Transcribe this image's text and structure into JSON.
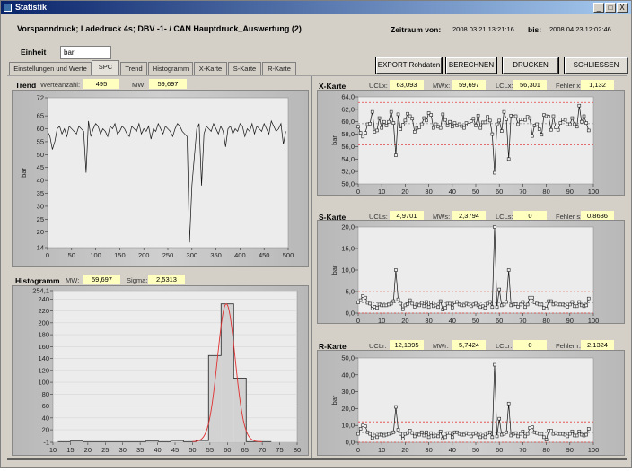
{
  "window": {
    "title": "Statistik",
    "minimize": "_",
    "maximize": "□",
    "close": "X"
  },
  "header": {
    "title": "Vorspanndruck; Ladedruck 4s; DBV -1- / CAN Hauptdruck_Auswertung (2)",
    "zeitraum_label": "Zeitraum von:",
    "from": "2008.03.21 13:21:16",
    "bis_label": "bis:",
    "to": "2008.04.23 12:02:46"
  },
  "einheit": {
    "label": "Einheit",
    "value": "bar"
  },
  "tabs": [
    {
      "label": "Einstellungen und Werte"
    },
    {
      "label": "SPC",
      "active": true
    },
    {
      "label": "Trend"
    },
    {
      "label": "Histogramm"
    },
    {
      "label": "X-Karte"
    },
    {
      "label": "S-Karte"
    },
    {
      "label": "R-Karte"
    }
  ],
  "buttons": {
    "export": "EXPORT Rohdaten",
    "berechnen": "BERECHNEN",
    "drucken": "DRUCKEN",
    "schliessen": "SCHLIESSEN"
  },
  "trend": {
    "title": "Trend",
    "count_label": "Werteanzahl:",
    "count": "495",
    "mw_label": "MW:",
    "mw": "59,697"
  },
  "histogram": {
    "title": "Histogramm",
    "mw_label": "MW:",
    "mw": "59,697",
    "sigma_label": "Sigma:",
    "sigma": "2,5313"
  },
  "xkarte": {
    "title": "X-Karte",
    "ucl_label": "UCLx:",
    "ucl": "63,093",
    "mw_label": "MWx:",
    "mw": "59,697",
    "lcl_label": "LCLx:",
    "lcl": "56,301",
    "err_label": "Fehler x:",
    "err": "1,132"
  },
  "skarte": {
    "title": "S-Karte",
    "ucl_label": "UCLs:",
    "ucl": "4,9701",
    "mw_label": "MWs:",
    "mw": "2,3794",
    "lcl_label": "LCLs:",
    "lcl": "0",
    "err_label": "Fehler s:",
    "err": "0,8636"
  },
  "rkarte": {
    "title": "R-Karte",
    "ucl_label": "UCLr:",
    "ucl": "12,1395",
    "mw_label": "MWr:",
    "mw": "5,7424",
    "lcl_label": "LCLr:",
    "lcl": "0",
    "err_label": "Fehler r:",
    "err": "2,1324"
  },
  "chart_data": [
    {
      "id": "trend",
      "type": "line",
      "ylabel": "bar",
      "xlim": [
        0,
        500
      ],
      "ylim": [
        14,
        72
      ],
      "xticks": [
        0,
        50,
        100,
        150,
        200,
        250,
        300,
        350,
        400,
        450,
        500
      ],
      "yticks": [
        14,
        20,
        25,
        30,
        35,
        40,
        45,
        50,
        55,
        60,
        65,
        72
      ],
      "x_start": 0,
      "x_step": 5,
      "values": [
        59,
        57,
        52,
        55,
        60,
        61,
        58,
        60,
        57,
        61,
        60,
        59,
        58,
        61,
        60,
        59,
        43,
        63,
        57,
        60,
        62,
        61,
        58,
        60,
        59,
        57,
        61,
        60,
        62,
        58,
        59,
        61,
        60,
        58,
        57,
        61,
        60,
        59,
        62,
        58,
        60,
        59,
        61,
        56,
        60,
        59,
        62,
        60,
        58,
        61,
        60,
        59,
        57,
        60,
        62,
        61,
        59,
        58,
        57,
        16,
        38,
        49,
        60,
        62,
        38,
        58,
        61,
        60,
        59,
        62,
        60,
        58,
        61,
        59,
        53,
        60,
        61,
        58,
        60,
        59,
        62,
        61,
        57,
        60,
        59,
        62,
        58,
        61,
        60,
        59,
        62,
        60,
        58,
        63,
        61,
        59,
        60,
        62,
        54,
        59
      ],
      "color": "#000000"
    },
    {
      "id": "histogram",
      "type": "bar",
      "xlim": [
        10,
        80
      ],
      "ylim": [
        -1,
        254.1
      ],
      "xticks": [
        10,
        15,
        20,
        25,
        30,
        35,
        40,
        45,
        50,
        55,
        60,
        65,
        70,
        75,
        80
      ],
      "yticks": [
        -1,
        20,
        40,
        60,
        80,
        100,
        120,
        140,
        160,
        180,
        200,
        220,
        240,
        254.1
      ],
      "bin_edges": [
        11.4,
        15,
        18.6,
        22.2,
        25.8,
        29.4,
        33,
        36.6,
        40.2,
        43.8,
        47.4,
        51,
        54.6,
        58.2,
        61.8,
        65.4,
        69,
        72.6
      ],
      "values": [
        0,
        1,
        0,
        0,
        0,
        0,
        0,
        1,
        0,
        2,
        0,
        2,
        145,
        232,
        107,
        0,
        0
      ],
      "fit": {
        "type": "normal",
        "mean": 59.697,
        "sigma": 2.5313,
        "color": "#e03030"
      }
    },
    {
      "id": "xkarte",
      "type": "line",
      "ylabel": "bar",
      "xlim": [
        0,
        100
      ],
      "ylim": [
        50,
        64
      ],
      "xticks": [
        0,
        10,
        20,
        30,
        40,
        50,
        60,
        70,
        80,
        90,
        100
      ],
      "yticks": [
        50,
        52,
        54,
        56,
        58,
        60,
        62,
        64
      ],
      "ucl": 63.093,
      "center": 59.697,
      "lcl": 56.301,
      "values": [
        59.2,
        58.2,
        57.6,
        58.2,
        59.6,
        59.7,
        61.6,
        58.4,
        58.6,
        60.6,
        59,
        60,
        59.4,
        60,
        61.6,
        59.8,
        54.6,
        61.2,
        58.8,
        59.5,
        60.2,
        61.3,
        60.9,
        60.5,
        58.4,
        59,
        59.1,
        59.6,
        60.6,
        60.2,
        61.4,
        61.1,
        59,
        59.6,
        59.2,
        59,
        61.2,
        60.3,
        59.4,
        60,
        59.2,
        59.8,
        59.4,
        59.6,
        59.3,
        59,
        59.8,
        59.5,
        60.1,
        60.5,
        59.4,
        61,
        59,
        59.9,
        59.9,
        60.8,
        60.2,
        58,
        51.8,
        59.6,
        60.2,
        58.5,
        61.6,
        60.4,
        54,
        61,
        60.8,
        60.9,
        59.6,
        60.4,
        60.4,
        60.3,
        60.8,
        60.6,
        57.7,
        59.4,
        59.6,
        58.8,
        57.9,
        61.1,
        60.9,
        60.8,
        58.7,
        60.9,
        59.1,
        58.7,
        59.8,
        60.4,
        60.3,
        59.6,
        59.6,
        60.6,
        59.6,
        59.2,
        62.6,
        60,
        60.9,
        59.8,
        58.6
      ]
    },
    {
      "id": "skarte",
      "type": "line",
      "ylabel": "bar",
      "xlim": [
        0,
        100
      ],
      "ylim": [
        0,
        20
      ],
      "xticks": [
        0,
        10,
        20,
        30,
        40,
        50,
        60,
        70,
        80,
        90,
        100
      ],
      "yticks": [
        0,
        5,
        10,
        15,
        20
      ],
      "ucl": 4.9701,
      "center": 2.3794,
      "lcl": 0,
      "values": [
        2.5,
        3,
        4,
        3.6,
        2.4,
        2.2,
        1,
        1.5,
        1.2,
        2,
        1.8,
        1.8,
        1.8,
        2,
        2.2,
        2.8,
        10,
        3.2,
        2.2,
        0.9,
        1.8,
        2.1,
        3,
        2.2,
        1.5,
        2,
        1.8,
        2.4,
        1.6,
        2.6,
        1.4,
        2.5,
        1.6,
        1.8,
        1.4,
        2.8,
        0.8,
        1.2,
        2.2,
        2.2,
        1.3,
        2.5,
        2.6,
        2,
        1.8,
        1.8,
        2.2,
        2,
        1.6,
        2,
        2.2,
        1.8,
        1.4,
        1.6,
        1.2,
        2.2,
        2.6,
        1.4,
        20,
        1.4,
        5.5,
        1.8,
        2,
        2.6,
        10,
        1.8,
        2,
        2.1,
        1.5,
        2,
        2.6,
        1.4,
        2,
        3.6,
        3.6,
        2.5,
        2.2,
        2,
        2,
        1.2,
        1,
        2.8,
        2.8,
        2,
        2.2,
        2,
        2,
        2,
        1.8,
        1.5,
        2,
        2.6,
        1.6,
        1.6,
        2.6,
        1.8,
        1.6,
        1.8,
        3.4
      ]
    },
    {
      "id": "rkarte",
      "type": "line",
      "ylabel": "bar",
      "xlim": [
        0,
        100
      ],
      "ylim": [
        0,
        50
      ],
      "xticks": [
        0,
        10,
        20,
        30,
        40,
        50,
        60,
        70,
        80,
        90,
        100
      ],
      "yticks": [
        0,
        10,
        20,
        30,
        40,
        50
      ],
      "ucl": 12.1395,
      "center": 5.7424,
      "lcl": 0,
      "values": [
        5,
        8,
        10,
        9.5,
        6,
        5,
        2.5,
        4,
        3,
        4.5,
        4.5,
        4,
        4.5,
        5,
        5.5,
        6,
        21,
        7.5,
        5,
        2,
        5,
        5.5,
        7,
        5.5,
        3.5,
        5,
        4.5,
        6,
        4,
        6,
        3,
        5.5,
        3.5,
        4,
        3.5,
        6.5,
        2,
        3,
        5.5,
        5.5,
        3,
        6,
        6,
        5,
        4.5,
        4.5,
        5.5,
        5,
        3.5,
        5,
        5.5,
        4.5,
        3,
        4,
        3,
        5.5,
        6,
        3,
        46,
        3.5,
        14,
        4.5,
        5,
        6,
        23,
        4,
        5,
        5.5,
        3.5,
        5,
        6.5,
        3.5,
        5,
        8.5,
        9,
        6,
        5.5,
        5,
        5,
        3,
        1.5,
        7,
        7,
        5,
        5.5,
        5,
        5,
        5,
        4.5,
        3.5,
        5,
        6.5,
        4,
        4,
        6.5,
        4.5,
        4,
        4.5,
        8
      ]
    }
  ]
}
